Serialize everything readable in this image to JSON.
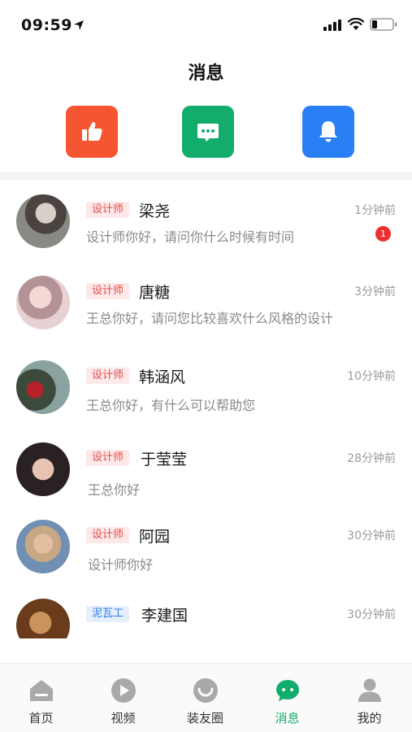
{
  "status": {
    "time": "09:59"
  },
  "header": {
    "title": "消息"
  },
  "quick_actions": [
    {
      "icon": "thumbs-up-icon",
      "color": "#f55530"
    },
    {
      "icon": "chat-bubble-icon",
      "color": "#12ac6d"
    },
    {
      "icon": "bell-icon",
      "color": "#2b7ff4"
    }
  ],
  "messages": [
    {
      "tag": "设计师",
      "name": "梁尧",
      "preview": "设计师你好，请问你什么时候有时间",
      "time": "1分钟前",
      "unread": "1"
    },
    {
      "tag": "设计师",
      "name": "唐糖",
      "preview": "王总你好，请问您比较喜欢什么风格的设计",
      "time": "3分钟前"
    },
    {
      "tag": "设计师",
      "name": "韩涵风",
      "preview": "王总你好，有什么可以帮助您",
      "time": "10分钟前"
    },
    {
      "tag": "设计师",
      "name": "于莹莹",
      "preview": "王总你好",
      "time": "28分钟前"
    },
    {
      "tag": "设计师",
      "name": "阿园",
      "preview": "设计师你好",
      "time": "30分钟前"
    },
    {
      "tag": "泥瓦工",
      "name": "李建国",
      "preview": "",
      "time": "30分钟前"
    }
  ],
  "tabbar": {
    "items": [
      {
        "label": "首页",
        "icon": "home-icon"
      },
      {
        "label": "视频",
        "icon": "play-icon"
      },
      {
        "label": "装友圈",
        "icon": "smile-icon"
      },
      {
        "label": "消息",
        "icon": "chat-icon",
        "active": true
      },
      {
        "label": "我的",
        "icon": "user-icon"
      }
    ]
  },
  "colors": {
    "accent": "#12ac6d",
    "badge": "#ee2f2f",
    "designer_tag": "#e24a4a",
    "worker_tag": "#2f7be8"
  }
}
